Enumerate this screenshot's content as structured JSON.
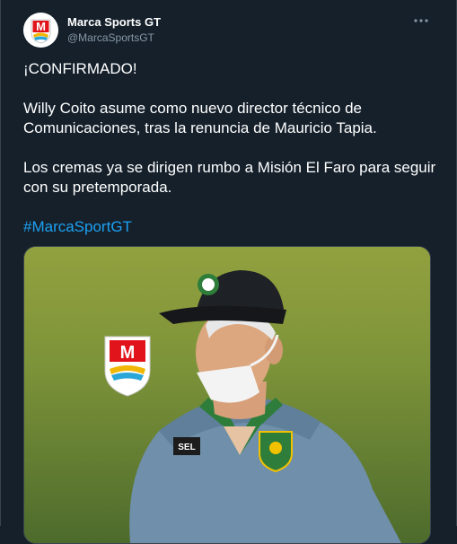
{
  "tweet": {
    "author": {
      "display_name": "Marca Sports GT",
      "handle": "@MarcaSportsGT",
      "avatar_letter": "M"
    },
    "more_icon": "more-horizontal-icon",
    "paragraphs": [
      "¡CONFIRMADO!",
      "Willy Coito asume como nuevo director técnico de Comunicaciones, tras la renuncia de Mauricio Tapia.",
      "Los cremas ya se dirigen rumbo a Misión El Faro para seguir con su pretemporada."
    ],
    "hashtag": "#MarcaSportGT",
    "media": {
      "watermark_letter": "M",
      "shirt_logo": "SEL"
    }
  },
  "colors": {
    "background": "#15202b",
    "text": "#ffffff",
    "muted": "#8899a6",
    "link": "#1da1f2",
    "border": "#38444d"
  }
}
